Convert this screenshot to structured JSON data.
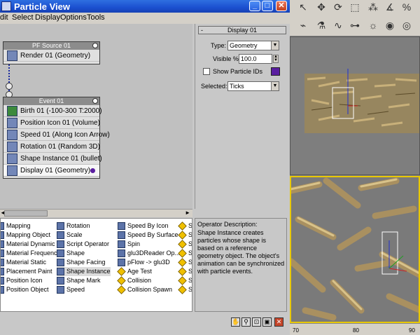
{
  "window": {
    "title": "Particle View"
  },
  "menu": [
    "dit",
    "Select",
    "Display",
    "Options",
    "Tools"
  ],
  "pf_source": {
    "title": "PF Source 01",
    "operators": [
      {
        "label": "Render 01 (Geometry)",
        "icon": "render-icon"
      }
    ]
  },
  "event": {
    "title": "Event 01",
    "operators": [
      {
        "label": "Birth 01 (-100-300 T:2000)",
        "icon": "birth-icon"
      },
      {
        "label": "Position Icon 01 (Volume)",
        "icon": "position-icon"
      },
      {
        "label": "Speed 01 (Along Icon Arrow)",
        "icon": "speed-icon"
      },
      {
        "label": "Rotation 01 (Random 3D)",
        "icon": "rotation-icon"
      },
      {
        "label": "Shape Instance 01 (bullet)",
        "icon": "shape-instance-icon"
      },
      {
        "label": "Display 01 (Geometry)",
        "icon": "display-icon"
      }
    ]
  },
  "params": {
    "rollout_title": "Display 01",
    "rollout_toggle": "-",
    "type_label": "Type:",
    "type_value": "Geometry",
    "visible_label": "Visible %",
    "visible_value": "100.0",
    "show_ids_label": "Show Particle IDs",
    "show_ids_checked": false,
    "color": "#5a1ea0",
    "selected_label": "Selected:",
    "selected_value": "Ticks"
  },
  "depot": {
    "columns": [
      [
        "Mapping",
        "Mapping Object",
        "Material Dynamic",
        "Material Frequency",
        "Material Static",
        "Placement Paint",
        "Position Icon",
        "Position Object"
      ],
      [
        "Rotation",
        "Scale",
        "Script Operator",
        "Shape",
        "Shape Facing",
        "Shape Instance",
        "Shape Mark",
        "Speed"
      ],
      [
        "Speed By Icon",
        "Speed By Surface",
        "Spin",
        "glu3DReader Op...",
        "pFlow -> glu3D",
        "Age Test",
        "Collision",
        "Collision Spawn"
      ],
      [
        "S",
        "S",
        "S",
        "S",
        "S",
        "S",
        "S",
        "S"
      ]
    ],
    "selected": "Shape Instance"
  },
  "description": {
    "title": "Operator Description:",
    "text": "Shape Instance creates particles whose shape is based on a reference geometry object. The object's animation can be synchronized with particle events."
  },
  "timeline": [
    "70",
    "80",
    "90"
  ]
}
